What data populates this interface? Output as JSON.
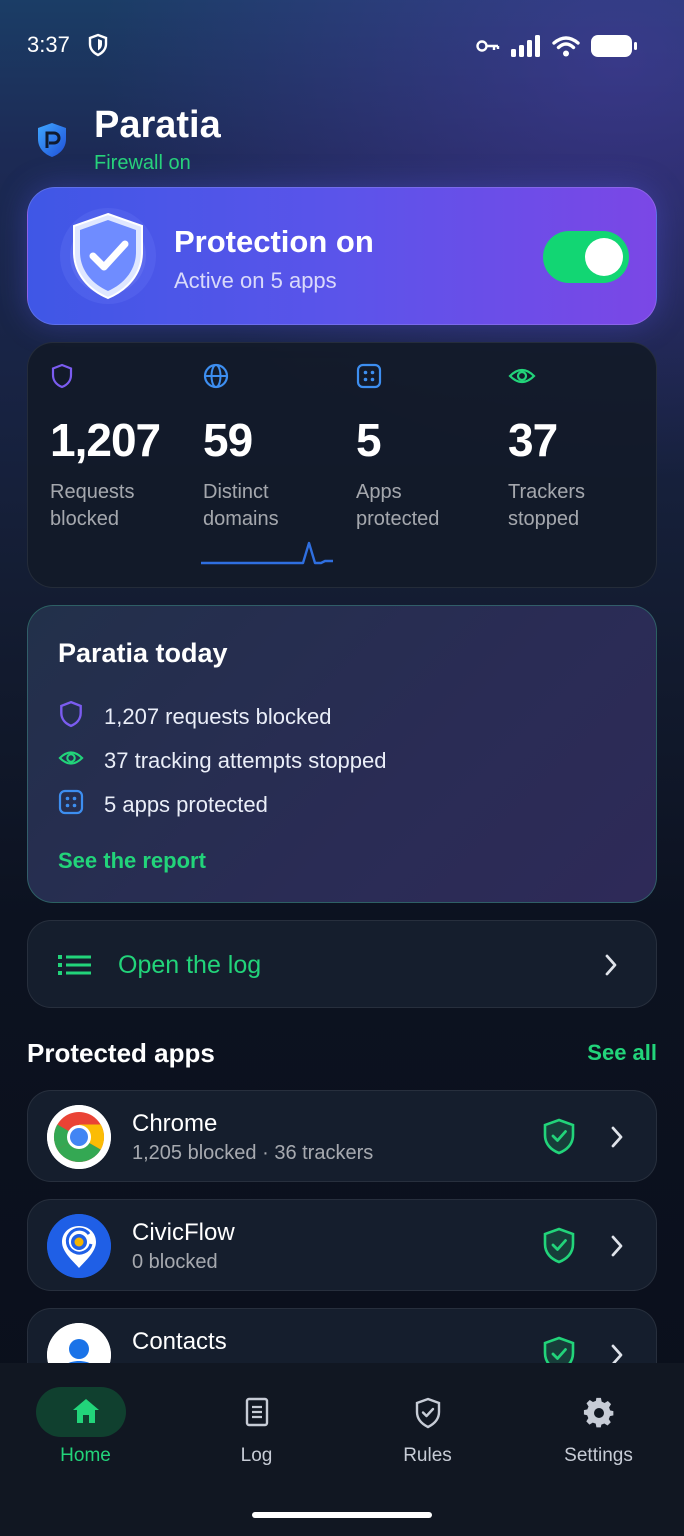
{
  "status_bar": {
    "time": "3:37"
  },
  "header": {
    "app_name": "Paratia",
    "firewall_status": "Firewall on"
  },
  "protection": {
    "title": "Protection on",
    "subtitle": "Active on 5 apps",
    "enabled": true
  },
  "stats": [
    {
      "value": "1,207",
      "label": "Requests blocked",
      "icon": "shield-icon",
      "color": "#7b5cf0"
    },
    {
      "value": "59",
      "label": "Distinct domains",
      "icon": "globe-icon",
      "color": "#3d8ef0"
    },
    {
      "value": "5",
      "label": "Apps protected",
      "icon": "apps-icon",
      "color": "#3d8ef0"
    },
    {
      "value": "37",
      "label": "Trackers stopped",
      "icon": "eye-icon",
      "color": "#22d47a"
    }
  ],
  "today": {
    "title": "Paratia today",
    "items": [
      {
        "text": "1,207 requests blocked",
        "icon": "shield-icon"
      },
      {
        "text": "37 tracking attempts stopped",
        "icon": "eye-icon"
      },
      {
        "text": "5 apps protected",
        "icon": "apps-icon"
      }
    ],
    "link": "See the report"
  },
  "log_row": {
    "label": "Open the log"
  },
  "protected_apps": {
    "title": "Protected apps",
    "see_all": "See all",
    "items": [
      {
        "name": "Chrome",
        "meta": "1,205 blocked · 36 trackers",
        "icon": "chrome-icon"
      },
      {
        "name": "CivicFlow",
        "meta": "0 blocked",
        "icon": "civicflow-icon"
      },
      {
        "name": "Contacts",
        "meta": "",
        "icon": "contacts-icon"
      }
    ]
  },
  "bottom_nav": [
    {
      "label": "Home",
      "icon": "home-icon",
      "active": true
    },
    {
      "label": "Log",
      "icon": "document-icon",
      "active": false
    },
    {
      "label": "Rules",
      "icon": "shield-check-icon",
      "active": false
    },
    {
      "label": "Settings",
      "icon": "gear-icon",
      "active": false
    }
  ],
  "colors": {
    "accent_green": "#22d47a",
    "protection_gradient_start": "#3f57e6",
    "protection_gradient_end": "#7b47e6"
  }
}
